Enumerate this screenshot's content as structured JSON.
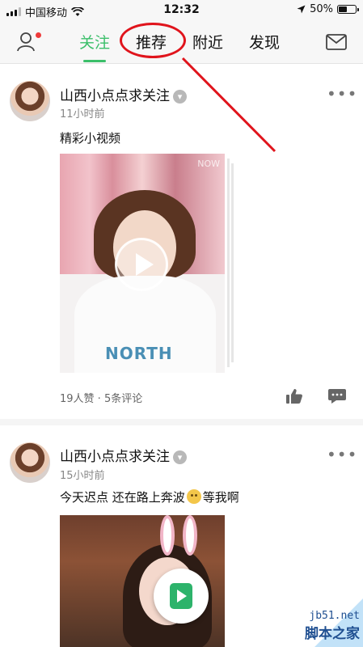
{
  "status_bar": {
    "carrier": "中国移动",
    "time": "12:32",
    "battery_percent": "50%",
    "battery_level": 0.5,
    "wifi_icon": "wifi-icon",
    "location_icon": "location-arrow-icon"
  },
  "nav": {
    "tabs": [
      "关注",
      "推荐",
      "附近",
      "发现"
    ],
    "active_tab": "关注",
    "profile_icon": "person-icon",
    "mail_icon": "mail-icon",
    "accent_color": "#3bbf6a"
  },
  "annotation": {
    "target": "推荐",
    "color": "#e0141c"
  },
  "posts": [
    {
      "author": "山西小点点求关注",
      "time": "11小时前",
      "caption": "精彩小视频",
      "video_watermark": "NOW",
      "shirt_text": "NORTH",
      "stats": "19人赞 · 5条评论"
    },
    {
      "author": "山西小点点求关注",
      "time": "15小时前",
      "caption_before": "今天迟点 还在路上奔波",
      "caption_after": "等我啊",
      "emoji": "dizzy-face-emoji"
    }
  ],
  "watermark": {
    "url": "jb51.net",
    "name": "脚本之家"
  }
}
